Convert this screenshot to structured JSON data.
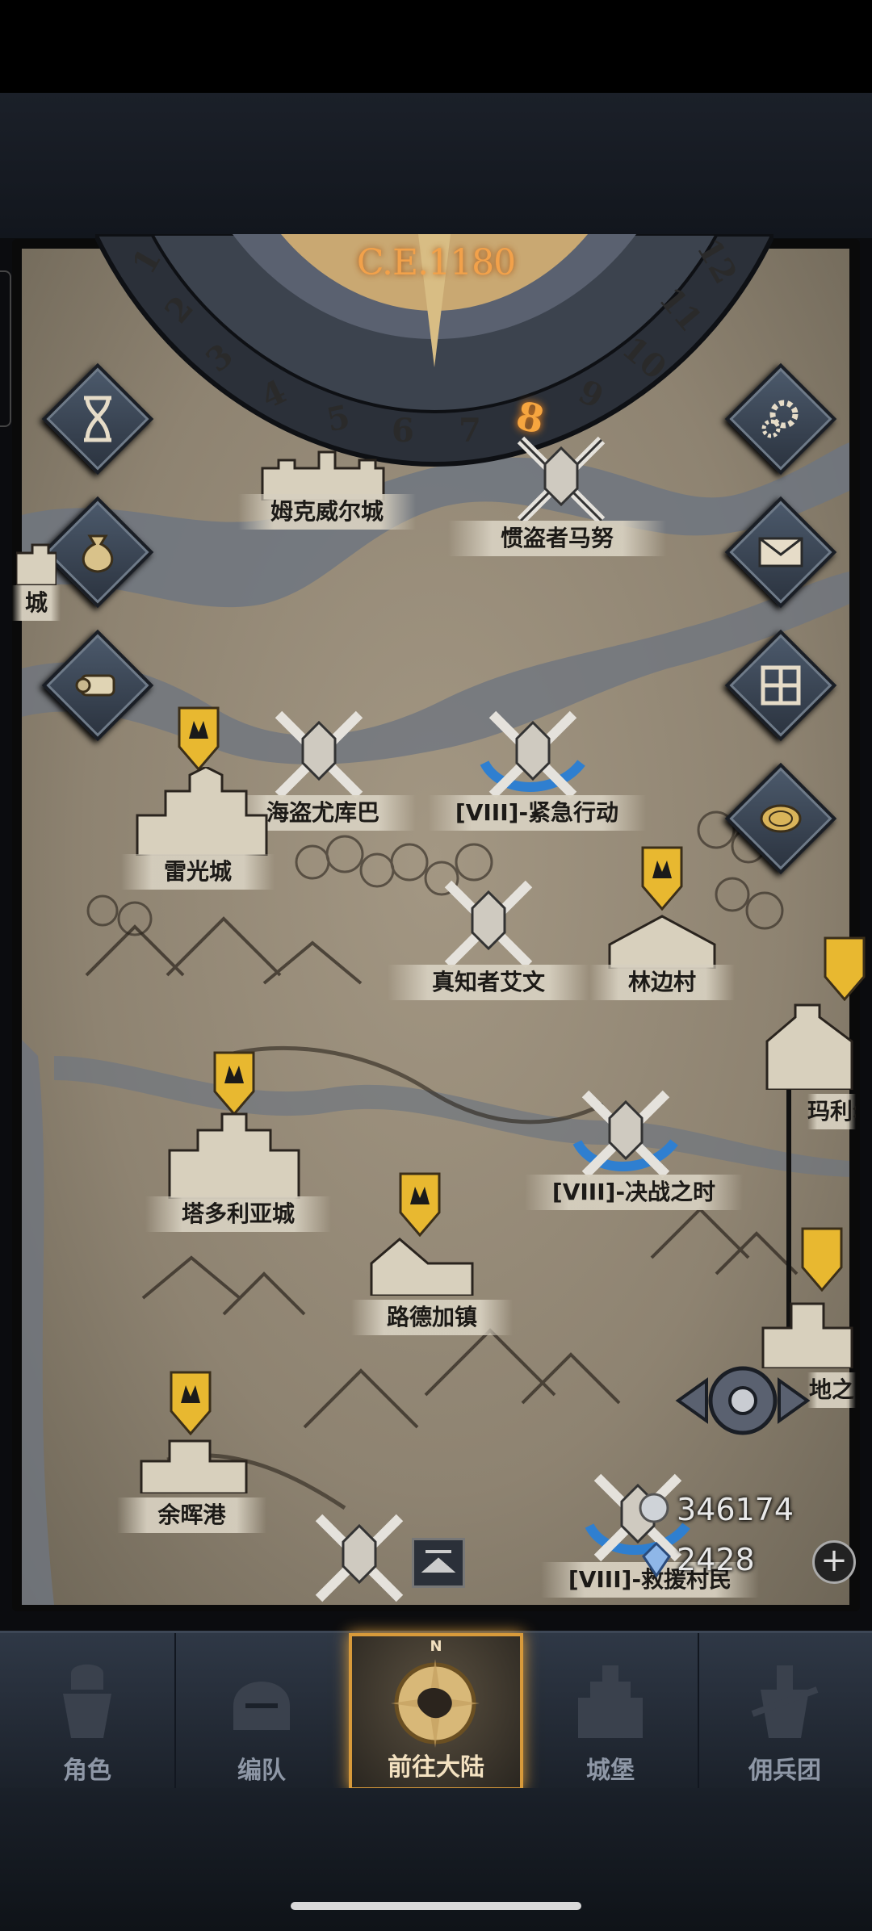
{
  "calendar": {
    "year": "C.E.1180",
    "months": [
      "1",
      "2",
      "3",
      "4",
      "5",
      "6",
      "7",
      "8",
      "9",
      "10",
      "11",
      "12"
    ],
    "active_month": "8"
  },
  "locations": [
    {
      "name": "姆克威尔城"
    },
    {
      "name": "惯盗者马努"
    },
    {
      "name": "城"
    },
    {
      "name": "海盗尤库巴"
    },
    {
      "name": "[VIII]-紧急行动"
    },
    {
      "name": "雷光城"
    },
    {
      "name": "真知者艾文"
    },
    {
      "name": "林边村"
    },
    {
      "name": "玛利尔"
    },
    {
      "name": "塔多利亚城"
    },
    {
      "name": "[VIII]-决战之时"
    },
    {
      "name": "路德加镇"
    },
    {
      "name": "地之"
    },
    {
      "name": "余晖港"
    },
    {
      "name": "[VIII]-救援村民"
    }
  ],
  "currency": {
    "silver": "346174",
    "crystal": "2428"
  },
  "side_buttons_left": [
    "hourglass-icon",
    "money-bag-icon",
    "scroll-icon"
  ],
  "side_buttons_right": [
    "gear-icon",
    "mail-icon",
    "window-icon",
    "coin-icon"
  ],
  "nav": {
    "items": [
      {
        "label": "角色",
        "icon": "knight-icon"
      },
      {
        "label": "编队",
        "icon": "helmet-icon"
      },
      {
        "label": "前往大陆",
        "icon": "compass-icon"
      },
      {
        "label": "城堡",
        "icon": "castle-icon"
      },
      {
        "label": "佣兵团",
        "icon": "mercenary-icon"
      }
    ],
    "active_index": 2
  },
  "compass_letter": "N",
  "colors": {
    "accent": "#f2a14a",
    "map_bg": "#a39783",
    "nav_bg": "#2f3846",
    "banner_gold": "#e8b830"
  }
}
